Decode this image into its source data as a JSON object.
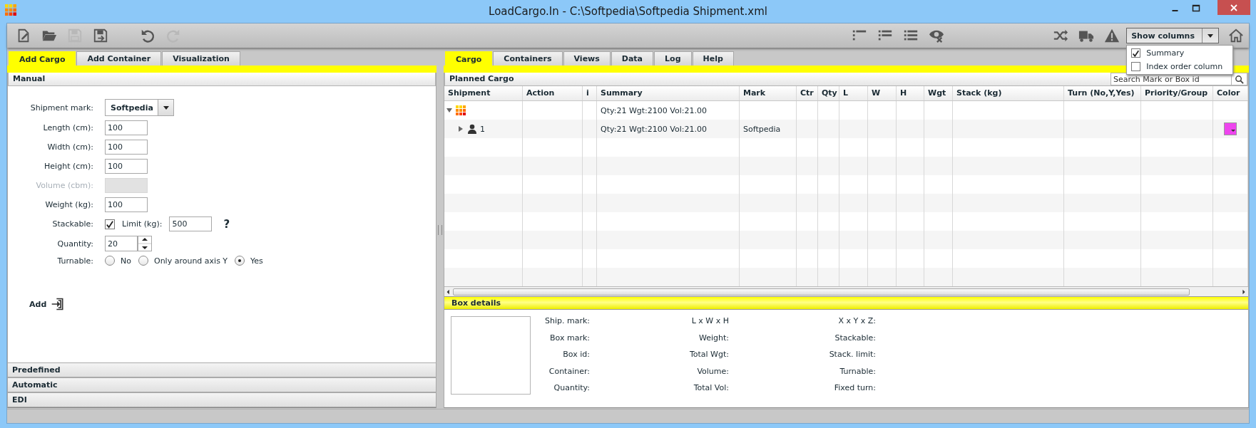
{
  "window": {
    "title": "LoadCargo.In - C:\\Softpedia\\Softpedia Shipment.xml"
  },
  "toolbar": {
    "file_tools": [
      {
        "kind": "new",
        "disabled": false
      },
      {
        "kind": "open",
        "disabled": false
      },
      {
        "kind": "save",
        "disabled": true
      },
      {
        "kind": "save-as",
        "disabled": false
      }
    ],
    "history_tools": [
      {
        "kind": "undo",
        "disabled": false
      },
      {
        "kind": "redo",
        "disabled": true
      }
    ],
    "view_tools": [
      {
        "kind": "list-short"
      },
      {
        "kind": "list-partial"
      },
      {
        "kind": "list-full"
      },
      {
        "kind": "hide"
      }
    ],
    "action_tools": [
      {
        "kind": "shuffle"
      },
      {
        "kind": "truck"
      },
      {
        "kind": "warning"
      }
    ],
    "show_columns": {
      "label": "Show columns",
      "expanded": true,
      "menu": [
        {
          "label": "Summary",
          "checked": true
        },
        {
          "label": "Index order column",
          "checked": false
        }
      ]
    }
  },
  "left_panel": {
    "tabs": [
      {
        "label": "Add Cargo",
        "selected": true
      },
      {
        "label": "Add Container",
        "selected": false
      },
      {
        "label": "Visualization",
        "selected": false
      }
    ],
    "sections": [
      {
        "label": "Manual",
        "expanded": true
      },
      {
        "label": "Predefined",
        "expanded": false
      },
      {
        "label": "Automatic",
        "expanded": false
      },
      {
        "label": "EDI",
        "expanded": false
      }
    ],
    "form": {
      "shipment_mark": {
        "label": "Shipment mark:",
        "value": "Softpedia"
      },
      "fields": [
        {
          "label": "Length (cm):",
          "value": "100",
          "disabled": false
        },
        {
          "label": "Width (cm):",
          "value": "100",
          "disabled": false
        },
        {
          "label": "Height (cm):",
          "value": "100",
          "disabled": false
        },
        {
          "label": "Volume (cbm):",
          "disabled": true
        },
        {
          "label": "Weight (kg):",
          "value": "100",
          "disabled": false
        }
      ],
      "stackable": {
        "label": "Stackable:",
        "checked": true,
        "limit_label": "Limit (kg):",
        "limit_value": "500",
        "help": "?"
      },
      "quantity": {
        "label": "Quantity:",
        "value": "20"
      },
      "turnable": {
        "label": "Turnable:",
        "options": [
          {
            "label": "No",
            "selected": false
          },
          {
            "label": "Only around axis Y",
            "selected": false
          },
          {
            "label": "Yes",
            "selected": true
          }
        ]
      },
      "add_button": "Add"
    }
  },
  "right_panel": {
    "tabs": [
      {
        "label": "Cargo",
        "selected": true
      },
      {
        "label": "Containers",
        "selected": false
      },
      {
        "label": "Views",
        "selected": false
      },
      {
        "label": "Data",
        "selected": false
      },
      {
        "label": "Log",
        "selected": false
      },
      {
        "label": "Help",
        "selected": false
      }
    ],
    "planned_cargo": {
      "title": "Planned Cargo",
      "search": {
        "placeholder": "Search Mark or Box id"
      },
      "columns": [
        "Shipment",
        "Action",
        "i",
        "Summary",
        "Mark",
        "Ctr",
        "Qty",
        "L",
        "W",
        "H",
        "Wgt",
        "Stack (kg)",
        "Turn (No,Y,Yes)",
        "Priority/Group",
        "Color"
      ],
      "rows": [
        {
          "kind": "group",
          "expanded": true,
          "summary": "Qty:21 Wgt:2100 Vol:21.00",
          "children": [
            {
              "kind": "shipment",
              "expanded": false,
              "label": "1",
              "summary": "Qty:21 Wgt:2100 Vol:21.00",
              "mark": "Softpedia",
              "color": "#ee44ee"
            }
          ]
        }
      ]
    },
    "box_details": {
      "title": "Box details",
      "columns": [
        {
          "labels": [
            "Ship. mark:",
            "Box mark:",
            "Box id:",
            "Container:",
            "Quantity:"
          ]
        },
        {
          "labels": [
            "L x W x H",
            "Weight:",
            "Total Wgt:",
            "Volume:",
            "Total Vol:"
          ]
        },
        {
          "labels": [
            "X x Y x Z:",
            "Stackable:",
            "Stack. limit:",
            "Turnable:",
            "Fixed turn:"
          ]
        }
      ]
    }
  }
}
